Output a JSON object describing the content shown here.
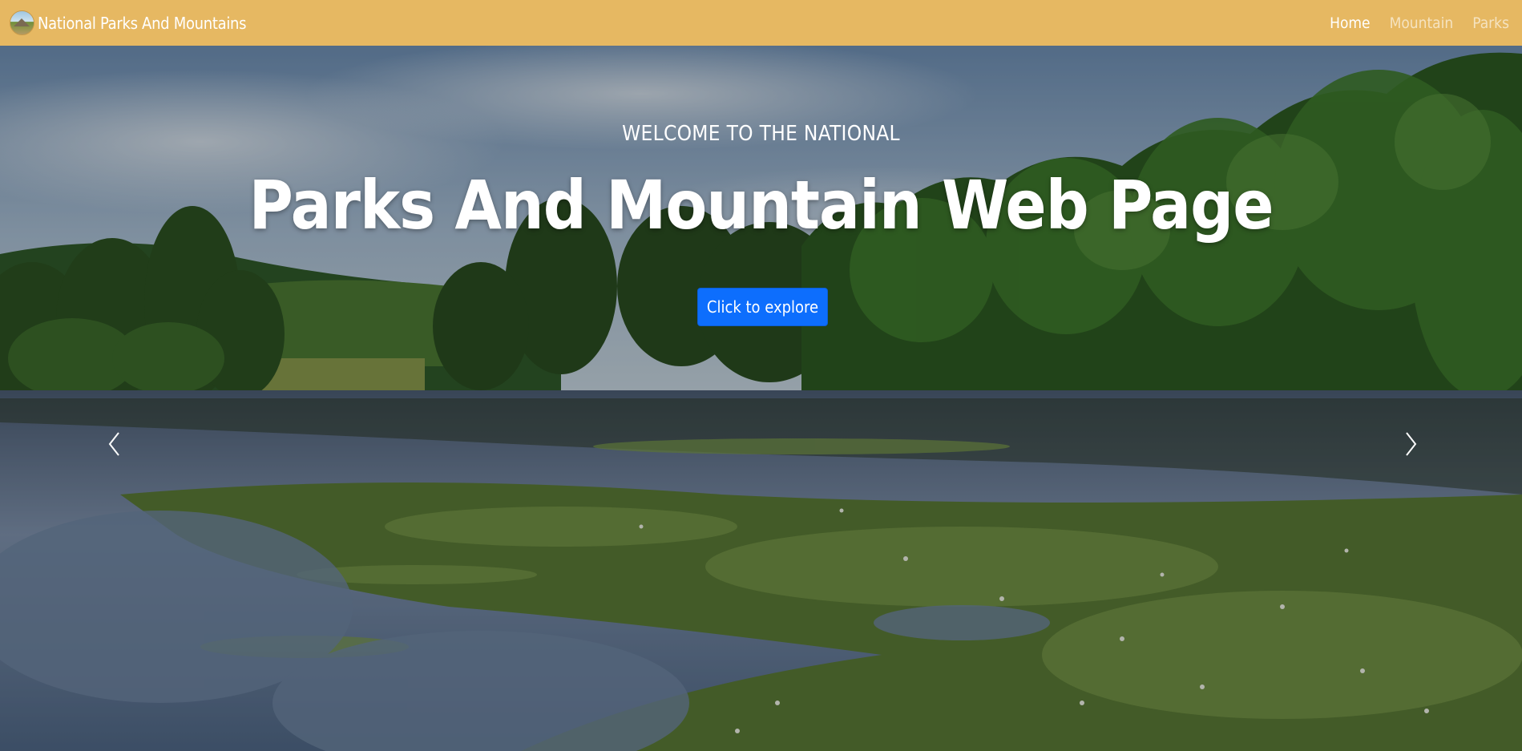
{
  "navbar": {
    "brand": "National Parks And Mountains",
    "links": [
      "Home",
      "Mountain",
      "Parks"
    ],
    "active_link": "Home"
  },
  "hero": {
    "subtitle": "WELCOME TO THE NATIONAL",
    "title": "Parks And Mountain Web Page",
    "cta_label": "Click to explore"
  },
  "colors": {
    "navbar_bg": "#e6b862",
    "cta_bg": "#0d6efd"
  },
  "icons": {
    "prev": "chevron-left-icon",
    "next": "chevron-right-icon",
    "brand": "park-logo-icon"
  }
}
